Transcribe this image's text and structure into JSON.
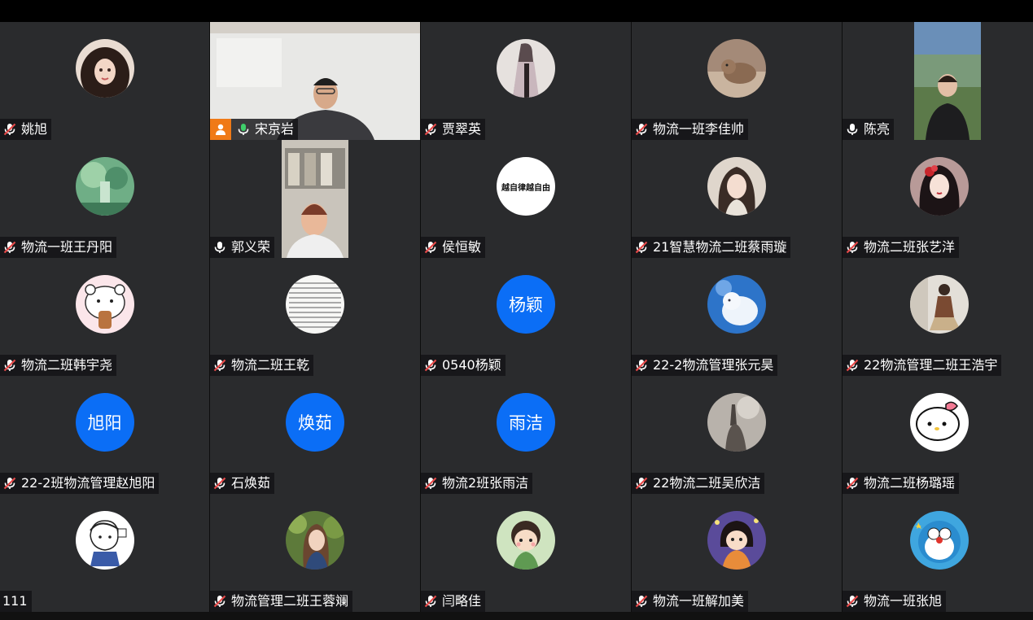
{
  "colors": {
    "avatar_blue": "#0b6ef6",
    "tile_bg": "#2a2b2d",
    "active_border": "#3fcf6a",
    "host_badge": "#f07a17",
    "mic_on": "#3fcf6a"
  },
  "participants": [
    {
      "name": "姚旭",
      "mic": "muted",
      "avatar": "photo"
    },
    {
      "name": "宋京岩",
      "mic": "on",
      "avatar": "video",
      "host": true,
      "active": true
    },
    {
      "name": "贾翠英",
      "mic": "muted",
      "avatar": "photo"
    },
    {
      "name": "物流一班李佳帅",
      "mic": "muted",
      "avatar": "photo"
    },
    {
      "name": "陈亮",
      "mic": "unmuted",
      "avatar": "video"
    },
    {
      "name": "物流一班王丹阳",
      "mic": "muted",
      "avatar": "photo"
    },
    {
      "name": "郭义荣",
      "mic": "unmuted",
      "avatar": "video"
    },
    {
      "name": "侯恒敏",
      "mic": "muted",
      "avatar": "photo",
      "avatar_text": "越自律越自由"
    },
    {
      "name": "21智慧物流二班蔡雨璇",
      "mic": "muted",
      "avatar": "photo"
    },
    {
      "name": "物流二班张艺洋",
      "mic": "muted",
      "avatar": "photo"
    },
    {
      "name": "物流二班韩宇尧",
      "mic": "muted",
      "avatar": "photo"
    },
    {
      "name": "物流二班王乾",
      "mic": "muted",
      "avatar": "photo"
    },
    {
      "name": "0540杨颖",
      "mic": "muted",
      "avatar": "text",
      "initials": "杨颖"
    },
    {
      "name": "22-2物流管理张元昊",
      "mic": "muted",
      "avatar": "photo"
    },
    {
      "name": "22物流管理二班王浩宇",
      "mic": "muted",
      "avatar": "photo"
    },
    {
      "name": "22-2班物流管理赵旭阳",
      "mic": "muted",
      "avatar": "text",
      "initials": "旭阳"
    },
    {
      "name": "石焕茹",
      "mic": "muted",
      "avatar": "text",
      "initials": "焕茹"
    },
    {
      "name": "物流2班张雨洁",
      "mic": "muted",
      "avatar": "text",
      "initials": "雨洁"
    },
    {
      "name": "22物流二班吴欣洁",
      "mic": "muted",
      "avatar": "photo"
    },
    {
      "name": "物流二班杨璐瑶",
      "mic": "muted",
      "avatar": "photo"
    },
    {
      "name": "111",
      "mic": "none",
      "avatar": "photo"
    },
    {
      "name": "物流管理二班王蓉斓",
      "mic": "muted",
      "avatar": "photo"
    },
    {
      "name": "闫略佳",
      "mic": "muted",
      "avatar": "photo"
    },
    {
      "name": "物流一班解加美",
      "mic": "muted",
      "avatar": "photo"
    },
    {
      "name": "物流一班张旭",
      "mic": "muted",
      "avatar": "photo"
    }
  ]
}
